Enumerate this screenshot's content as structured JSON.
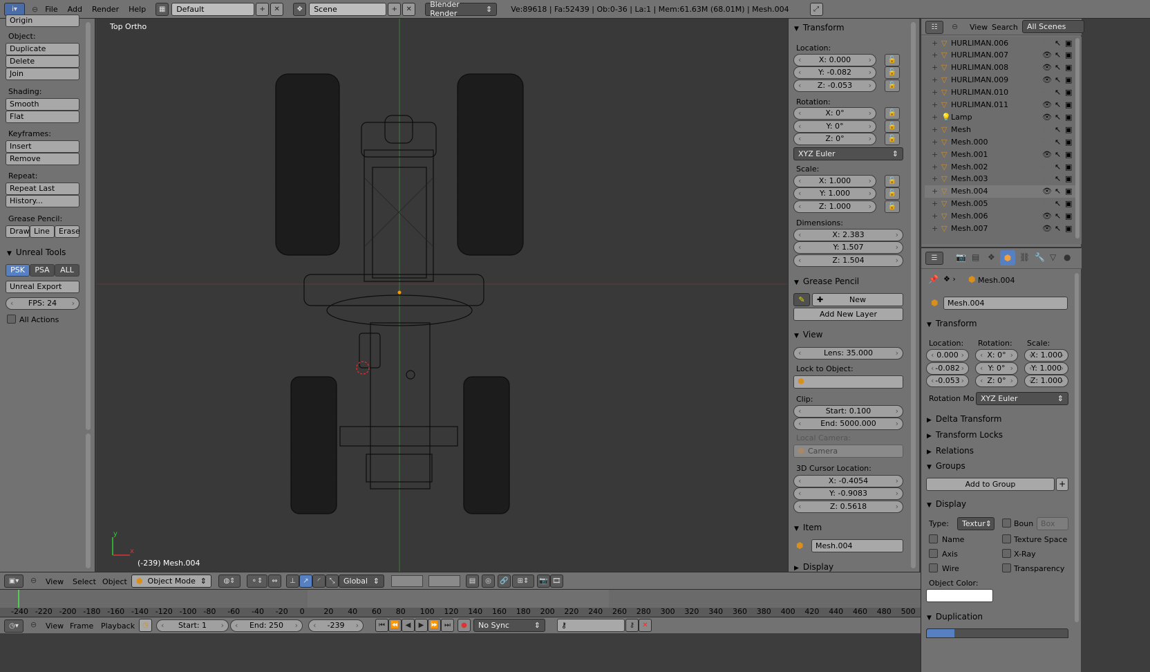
{
  "topbar": {
    "menu": [
      "File",
      "Add",
      "Render",
      "Help"
    ],
    "screen": "Default",
    "scene": "Scene",
    "engine": "Blender Render",
    "stats": "Ve:89618 | Fa:52439 | Ob:0-36 | La:1 | Mem:61.63M (68.01M) | Mesh.004"
  },
  "toolshelf": {
    "origin": "Origin",
    "object_label": "Object:",
    "object_btns": [
      "Duplicate",
      "Delete",
      "Join"
    ],
    "shading_label": "Shading:",
    "shading_btns": [
      "Smooth",
      "Flat"
    ],
    "keyframes_label": "Keyframes:",
    "keyframe_btns": [
      "Insert",
      "Remove"
    ],
    "repeat_label": "Repeat:",
    "repeat_btns": [
      "Repeat Last",
      "History..."
    ],
    "grease_label": "Grease Pencil:",
    "grease_btns": [
      "Draw",
      "Line",
      "Erase"
    ],
    "unreal_title": "Unreal Tools",
    "unreal_tabs": [
      "PSK",
      "PSA",
      "ALL"
    ],
    "unreal_export": "Unreal Export",
    "fps": "FPS: 24",
    "all_actions": "All Actions"
  },
  "viewport": {
    "view_name": "Top Ortho",
    "object_info": "(-239) Mesh.004"
  },
  "npanel": {
    "transform_title": "Transform",
    "location_label": "Location:",
    "loc": [
      "X: 0.000",
      "Y: -0.082",
      "Z: -0.053"
    ],
    "rotation_label": "Rotation:",
    "rot": [
      "X: 0°",
      "Y: 0°",
      "Z: 0°"
    ],
    "rot_mode": "XYZ Euler",
    "scale_label": "Scale:",
    "scale": [
      "X: 1.000",
      "Y: 1.000",
      "Z: 1.000"
    ],
    "dim_label": "Dimensions:",
    "dim": [
      "X: 2.383",
      "Y: 1.507",
      "Z: 1.504"
    ],
    "grease_title": "Grease Pencil",
    "grease_new": "New",
    "grease_add_layer": "Add New Layer",
    "view_title": "View",
    "lens": "Lens: 35.000",
    "lock_obj_label": "Lock to Object:",
    "clip_label": "Clip:",
    "clip_start": "Start: 0.100",
    "clip_end": "End: 5000.000",
    "local_camera_label": "Local Camera:",
    "camera": "Camera",
    "cursor_label": "3D Cursor Location:",
    "cursor": [
      "X: -0.4054",
      "Y: -0.9083",
      "Z: 0.5618"
    ],
    "item_title": "Item",
    "item_name": "Mesh.004",
    "display_title": "Display"
  },
  "outliner": {
    "view": "View",
    "search": "Search",
    "scenes": "All Scenes",
    "rows": [
      {
        "name": "HURLIMAN.006",
        "eye": false
      },
      {
        "name": "HURLIMAN.007",
        "eye": true
      },
      {
        "name": "HURLIMAN.008",
        "eye": true
      },
      {
        "name": "HURLIMAN.009",
        "eye": true
      },
      {
        "name": "HURLIMAN.010",
        "eye": false
      },
      {
        "name": "HURLIMAN.011",
        "eye": true
      },
      {
        "name": "Lamp",
        "eye": true
      },
      {
        "name": "Mesh",
        "eye": false
      },
      {
        "name": "Mesh.000",
        "eye": false
      },
      {
        "name": "Mesh.001",
        "eye": true
      },
      {
        "name": "Mesh.002",
        "eye": false
      },
      {
        "name": "Mesh.003",
        "eye": false
      },
      {
        "name": "Mesh.004",
        "eye": true
      },
      {
        "name": "Mesh.005",
        "eye": false
      },
      {
        "name": "Mesh.006",
        "eye": true
      },
      {
        "name": "Mesh.007",
        "eye": true
      }
    ]
  },
  "properties": {
    "breadcrumb": "Mesh.004",
    "object_name": "Mesh.004",
    "transform_title": "Transform",
    "loc_label": "Location:",
    "rot_label": "Rotation:",
    "scale_label": "Scale:",
    "loc": [
      "0.000",
      "-0.082",
      "-0.053"
    ],
    "rot": [
      "X: 0°",
      "Y: 0°",
      "Z: 0°"
    ],
    "scale": [
      "X: 1.000",
      "Y: 1.000",
      "Z: 1.000"
    ],
    "rot_mode_label": "Rotation Mo",
    "rot_mode": "XYZ Euler",
    "delta": "Delta Transform",
    "locks": "Transform Locks",
    "relations": "Relations",
    "groups": "Groups",
    "add_group": "Add to Group",
    "display": "Display",
    "type_label": "Type:",
    "type_val": "Textur",
    "bounds": "Boun",
    "box": "Box",
    "name_cb": "Name",
    "texture_space": "Texture Space",
    "axis": "Axis",
    "xray": "X-Ray",
    "wire": "Wire",
    "transparency": "Transparency",
    "obj_color_label": "Object Color:",
    "duplication": "Duplication"
  },
  "header3d": {
    "menus": [
      "View",
      "Select",
      "Object"
    ],
    "mode": "Object Mode",
    "orientation": "Global"
  },
  "timeline": {
    "ticks": [
      "-240",
      "-220",
      "-200",
      "-180",
      "-160",
      "-140",
      "-120",
      "-100",
      "-80",
      "-60",
      "-40",
      "-20",
      "0",
      "20",
      "40",
      "60",
      "80",
      "100",
      "120",
      "140",
      "160",
      "180",
      "200",
      "220",
      "240",
      "260",
      "280",
      "300",
      "320",
      "340",
      "360",
      "380",
      "400",
      "420",
      "440",
      "460",
      "480",
      "500"
    ],
    "menus": [
      "View",
      "Frame",
      "Playback"
    ],
    "start": "Start: 1",
    "end": "End: 250",
    "current": "-239",
    "sync": "No Sync"
  }
}
